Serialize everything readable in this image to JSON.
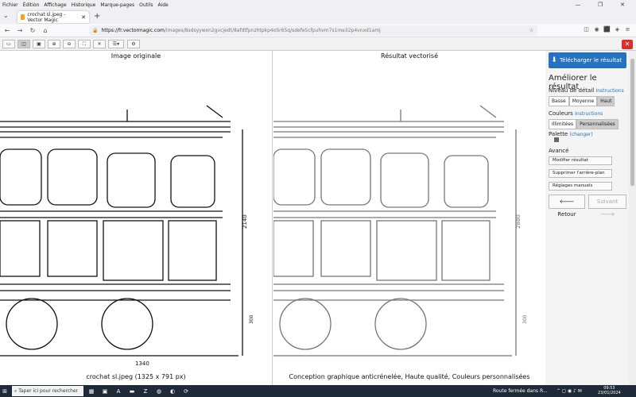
{
  "menu": [
    "Fichier",
    "Édition",
    "Affichage",
    "Historique",
    "Marque-pages",
    "Outils",
    "Aide"
  ],
  "tab": {
    "title": "crochat sl.jpeg - Vector Magic"
  },
  "url": {
    "domain": "https://fr.vectormagic.com",
    "path": "/images/8sdsyywxn2gvcjedt/8afdtfpnzhtpkp4oSr65q/sdefe5cfpuhvm7s1me32p4vnxd1amj"
  },
  "left": {
    "title": "Image originale",
    "caption": "crochat sl.jpeg (1325 x 791 px)"
  },
  "right": {
    "title": "Résultat vectorisé",
    "caption": "Conception graphique anticrénelée, Haute qualité, Couleurs personnalisées"
  },
  "panel": {
    "download": "Télécharger le résultat",
    "heading": "Améliorer le résultat",
    "detail_label": "Niveau de détail",
    "instructions": "Instructions",
    "detail_options": [
      "Basse",
      "Moyenne",
      "Haut"
    ],
    "colors_label": "Couleurs",
    "color_options": [
      "Illimitées",
      "Personnalisées"
    ],
    "palette_label": "Palette",
    "palette_change": "(changer)",
    "advanced_label": "Avancé",
    "advanced_buttons": [
      "Modifier résultat",
      "Supprimer l'arrière-plan",
      "Réglages manuels"
    ],
    "back": "Retour",
    "next": "Suivant"
  },
  "drawing": {
    "dims": [
      "2140",
      "2880",
      "300",
      "1340"
    ]
  },
  "taskbar": {
    "search": "Taper ici pour rechercher",
    "notification": "Route fermée dans R...",
    "time": "09:53",
    "date": "23/01/2024"
  }
}
